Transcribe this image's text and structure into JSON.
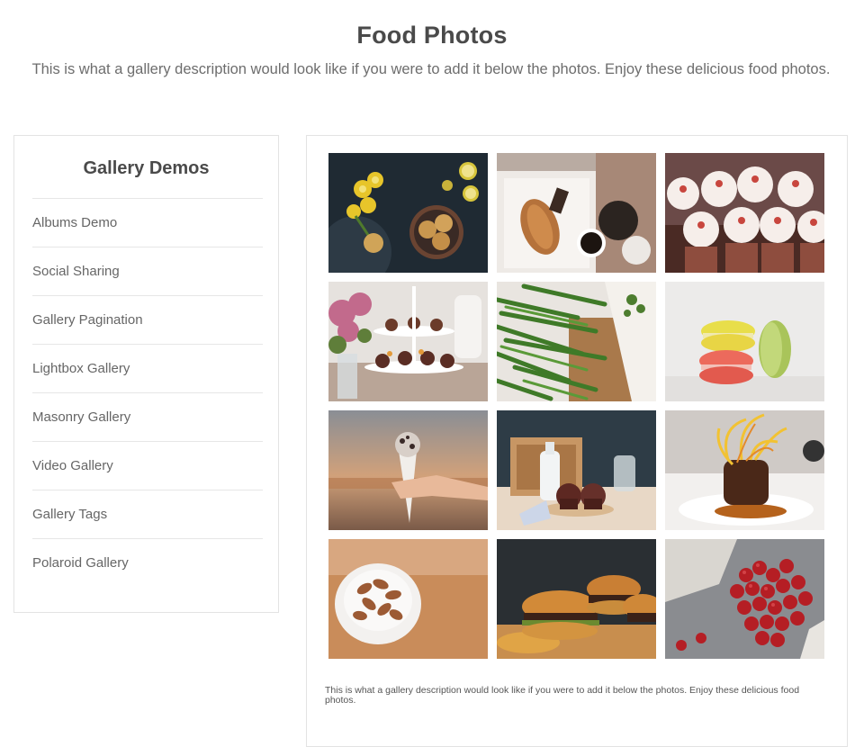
{
  "header": {
    "title": "Food Photos",
    "description": "This is what a gallery description would look like if you were to add it below the photos. Enjoy these delicious food photos."
  },
  "sidebar": {
    "title": "Gallery Demos",
    "items": [
      {
        "label": "Albums Demo"
      },
      {
        "label": "Social Sharing"
      },
      {
        "label": "Gallery Pagination"
      },
      {
        "label": "Lightbox Gallery"
      },
      {
        "label": "Masonry Gallery"
      },
      {
        "label": "Video Gallery"
      },
      {
        "label": "Gallery Tags"
      },
      {
        "label": "Polaroid Gallery"
      }
    ]
  },
  "gallery": {
    "photos": [
      {
        "name": "daffodils-lemons-cookies-photo"
      },
      {
        "name": "croissant-coffee-photo"
      },
      {
        "name": "cupcakes-photo"
      },
      {
        "name": "flowers-dessert-stand-photo"
      },
      {
        "name": "green-beans-photo"
      },
      {
        "name": "macarons-photo"
      },
      {
        "name": "ice-cream-cone-photo"
      },
      {
        "name": "milk-muffins-photo"
      },
      {
        "name": "plated-dish-photo"
      },
      {
        "name": "almonds-bowl-photo"
      },
      {
        "name": "burgers-photo"
      },
      {
        "name": "cherries-photo"
      }
    ],
    "caption": "This is what a gallery description would look like if you were to add it below the photos. Enjoy these delicious food photos."
  },
  "colors": {
    "heading": "#4a4a4a",
    "text": "#666666",
    "border": "#e3e3e3"
  }
}
